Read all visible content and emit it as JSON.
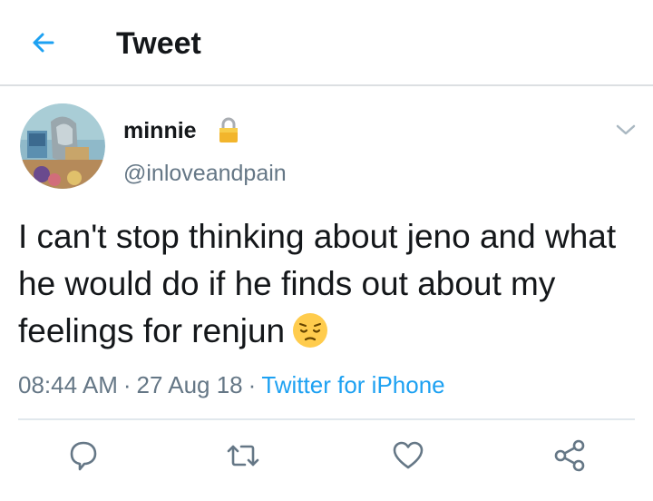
{
  "header": {
    "title": "Tweet",
    "back_icon": "arrow-left-icon",
    "accent_color": "#1da1f2"
  },
  "tweet": {
    "avatar_icon": "avatar-image",
    "display_name": "minnie",
    "protected_icon": "lock-icon",
    "handle": "@inloveandpain",
    "text": "I can't stop thinking about jeno and what he would do if he finds out about my feelings for renjun",
    "text_emoji": "pensive-face-emoji",
    "time": "08:44 AM",
    "date": "27 Aug 18",
    "separator": "·",
    "source": "Twitter for iPhone",
    "menu_icon": "chevron-down-icon"
  },
  "actions": {
    "reply_icon": "reply-icon",
    "retweet_icon": "retweet-icon",
    "like_icon": "heart-icon",
    "share_icon": "share-icon"
  }
}
